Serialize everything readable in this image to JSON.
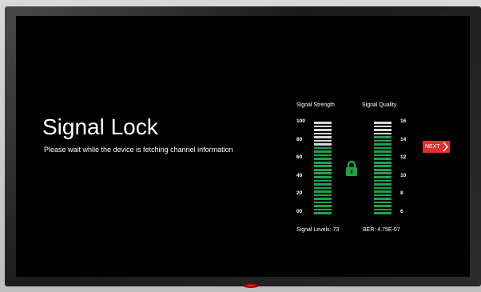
{
  "screen": {
    "title": "Signal Lock",
    "subtitle": "Please wait while the device is fetching channel information"
  },
  "signal_strength": {
    "label": "Signal Strength",
    "scale": [
      "100",
      "80",
      "60",
      "40",
      "20",
      "00"
    ],
    "segments_total": 26,
    "segments_lit": 19,
    "footer": "Signal Levels: 73"
  },
  "signal_quality": {
    "label": "Signal Quality",
    "scale": [
      "16",
      "14",
      "12",
      "10",
      "8",
      "6"
    ],
    "segments_total": 26,
    "segments_lit": 22,
    "footer": "BER: 4.75E-07"
  },
  "lock_icon": {
    "name": "padlock-icon",
    "color": "#1fa34a"
  },
  "next_button": {
    "label": "NEXT",
    "color": "#e0312f"
  },
  "colors": {
    "bar_active": "#1fa34a",
    "bar_inactive": "#d8d8d8",
    "background": "#000000"
  }
}
